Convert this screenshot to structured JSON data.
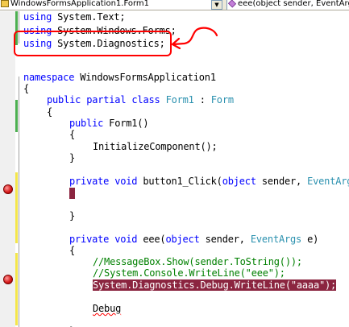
{
  "navbar": {
    "type_selector": "WindowsFormsApplication1.Form1",
    "member_selector": "eee(object sender, EventArgs e)",
    "dropdown_arrow": "▼",
    "type_icon": "class-icon",
    "member_icon": "method-icon"
  },
  "code": {
    "using_kw": "using",
    "using1": " System.Text;",
    "using2": " System.Windows.Forms;",
    "using3": " System.Diagnostics;",
    "namespace_kw": "namespace",
    "namespace_name": " WindowsFormsApplication1",
    "open_brace": "{",
    "close_brace": "}",
    "public_kw": "public",
    "partial_kw": "partial",
    "class_kw": "class",
    "form1_type": "Form1",
    "colon": " : ",
    "form_type": "Form",
    "ctor_sig": " Form1()",
    "init_call": "InitializeComponent();",
    "private_kw": "private",
    "void_kw": "void",
    "button1_name": " button1_Click(",
    "object_kw": "object",
    "sender_param": " sender, ",
    "eventargs_type": "EventArgs",
    "eventargs_cut": "EventArgs",
    "e_param": " e)",
    "eee_name": " eee(",
    "comment1": "//MessageBox.Show(sender.ToString());",
    "comment2": "//System.Console.WriteLine(\"eee\");",
    "debug_line": "System.Diagnostics.Debug.WriteLine(\"aaaa\");",
    "debug_partial": "Debug"
  },
  "colors": {
    "keyword": "#0000ff",
    "type": "#2b91af",
    "comment": "#008000",
    "highlight": "#8b2540",
    "annotation": "#ff0000"
  }
}
